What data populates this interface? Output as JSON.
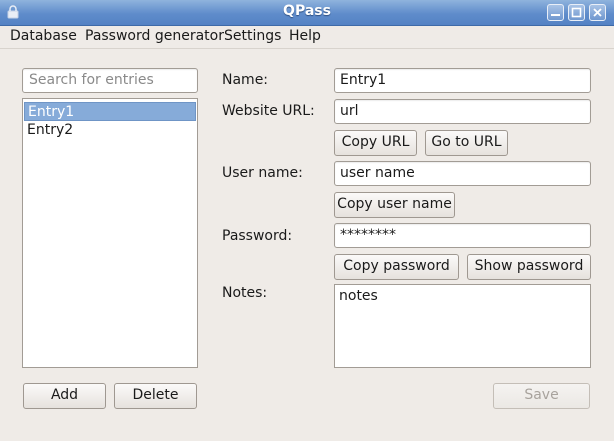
{
  "window": {
    "title": "QPass",
    "colors": {
      "titlebar": "#5f8ccb",
      "selection": "#86abd9",
      "background": "#efebe7"
    }
  },
  "menu": [
    "Database",
    "Password generator",
    "Settings",
    "Help"
  ],
  "search": {
    "placeholder": "Search for entries",
    "value": ""
  },
  "entries": [
    {
      "label": "Entry1",
      "selected": true
    },
    {
      "label": "Entry2",
      "selected": false
    }
  ],
  "left_buttons": {
    "add": "Add",
    "delete": "Delete"
  },
  "form": {
    "name_label": "Name:",
    "name_value": "Entry1",
    "url_label": "Website URL:",
    "url_value": "url",
    "copy_url": "Copy URL",
    "go_to_url": "Go to URL",
    "username_label": "User name:",
    "username_value": "user name",
    "copy_username": "Copy user name",
    "password_label": "Password:",
    "password_value": "********",
    "copy_password": "Copy password",
    "show_password": "Show password",
    "notes_label": "Notes:",
    "notes_value": "notes",
    "save": "Save"
  }
}
